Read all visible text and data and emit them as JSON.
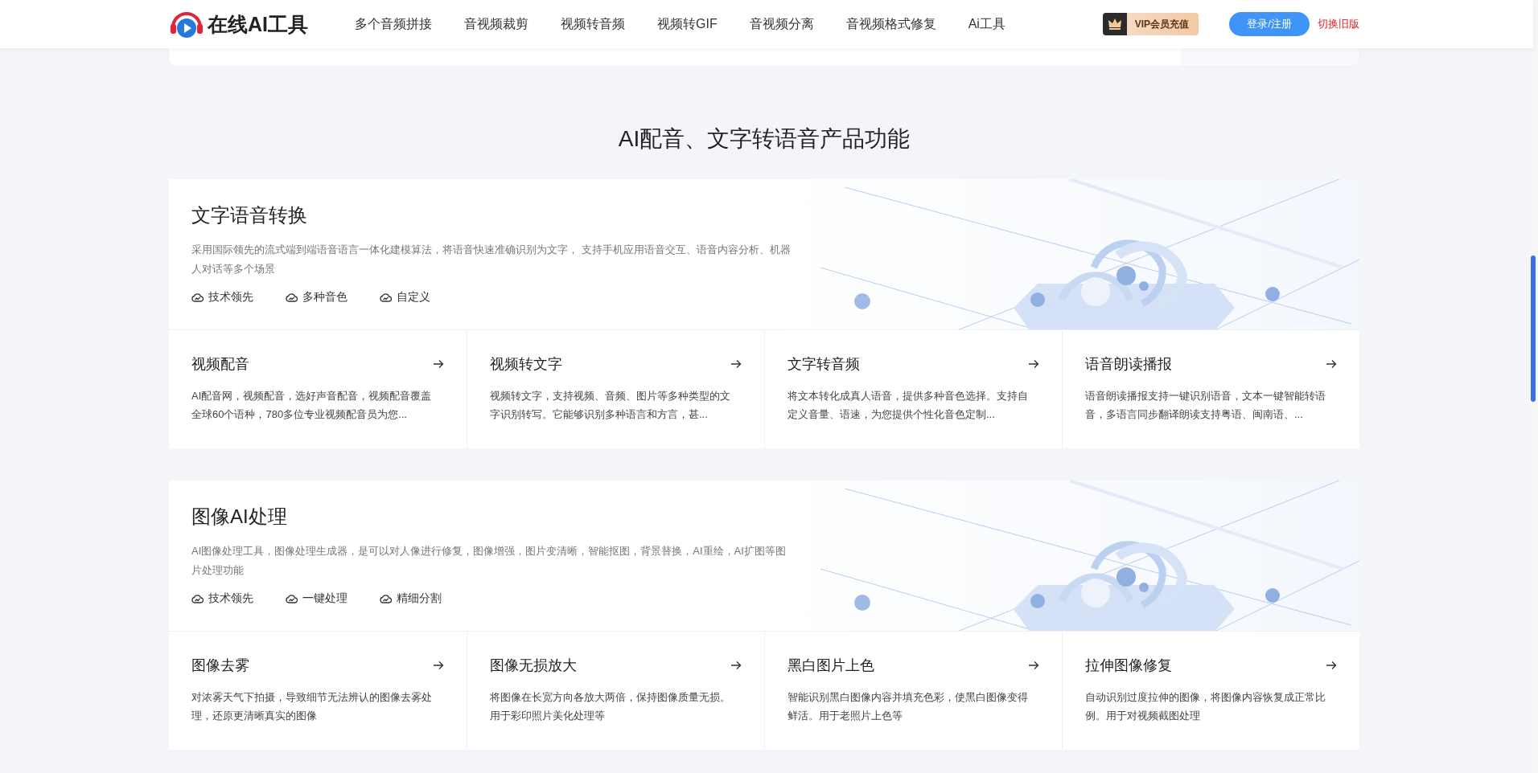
{
  "header": {
    "logo_text": "在线AI工具",
    "nav": [
      "多个音频拼接",
      "音视频裁剪",
      "视频转音频",
      "视频转GIF",
      "音视频分离",
      "音视频格式修复",
      "Ai工具"
    ],
    "vip_button": "VIP会员充值",
    "login_button": "登录/注册",
    "switch_link": "切换旧版"
  },
  "heading": "AI配音、文字转语音产品功能",
  "sections": [
    {
      "title": "文字语音转换",
      "description": "采用国际领先的流式端到端语音语言一体化建模算法，将语音快速准确识别为文字， 支持手机应用语音交互、语音内容分析、机器人对话等多个场景",
      "tags": [
        "技术领先",
        "多种音色",
        "自定义"
      ],
      "cards": [
        {
          "title": "视频配音",
          "description": "AI配音网，视频配音，选好声音配音，视频配音覆盖全球60个语种，780多位专业视频配音员为您..."
        },
        {
          "title": "视频转文字",
          "description": "视频转文字，支持视频、音频、图片等多种类型的文字识别转写。它能够识别多种语言和方言，甚..."
        },
        {
          "title": "文字转音频",
          "description": "将文本转化成真人语音，提供多种音色选择。支持自定义音量、语速，为您提供个性化音色定制..."
        },
        {
          "title": "语音朗读播报",
          "description": "语音朗读播报支持一键识别语音，文本一键智能转语音，多语言同步翻译朗读支持粤语、闽南语、..."
        }
      ]
    },
    {
      "title": "图像AI处理",
      "description": "AI图像处理工具，图像处理生成器，是可以对人像进行修复，图像增强，图片变清晰，智能抠图，背景替换，AI重绘，AI扩图等图片处理功能",
      "tags": [
        "技术领先",
        "一键处理",
        "精细分割"
      ],
      "cards": [
        {
          "title": "图像去雾",
          "description": "对浓雾天气下拍摄，导致细节无法辨认的图像去雾处理，还原更清晰真实的图像"
        },
        {
          "title": "图像无损放大",
          "description": "将图像在长宽方向各放大两倍，保持图像质量无损。用于彩印照片美化处理等"
        },
        {
          "title": "黑白图片上色",
          "description": "智能识别黑白图像内容并填充色彩，使黑白图像变得鲜活。用于老照片上色等"
        },
        {
          "title": "拉伸图像修复",
          "description": "自动识别过度拉伸的图像，将图像内容恢复成正常比例。用于对视频截图处理"
        }
      ]
    }
  ]
}
